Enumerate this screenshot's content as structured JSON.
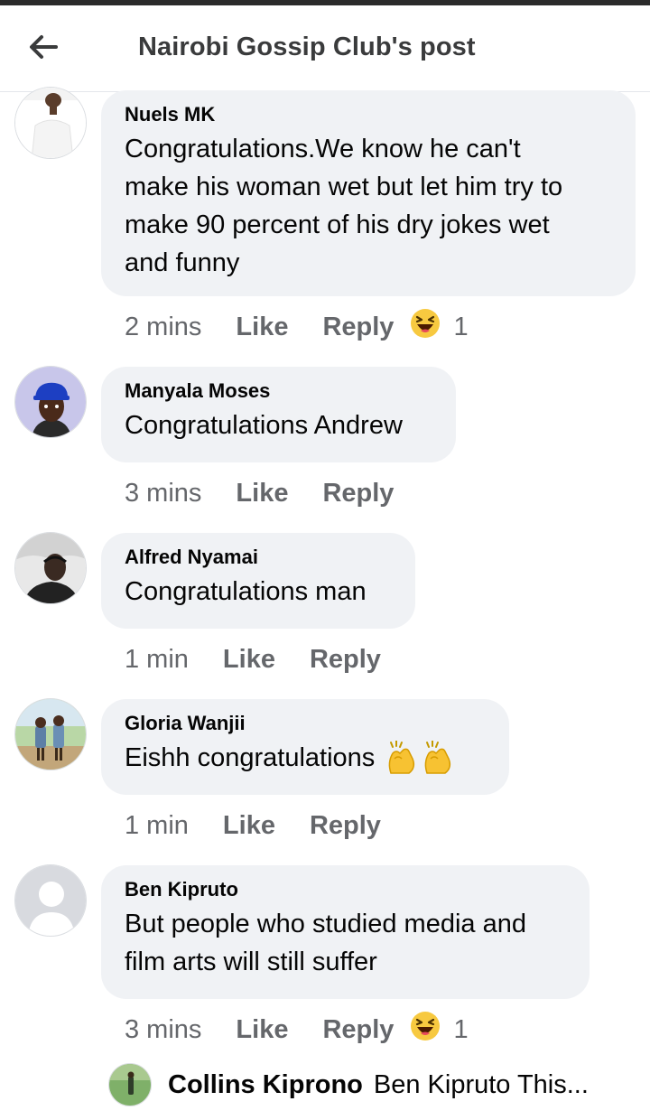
{
  "header": {
    "title": "Nairobi Gossip Club's post"
  },
  "icons": {
    "back": "arrow-left-icon",
    "haha": "haha-reaction-icon",
    "clap": "clapping-hands-emoji"
  },
  "comments": [
    {
      "author": "Nuels MK",
      "text": "Congratulations.We know he can't make his woman wet but let him try to make 90 percent of his dry jokes wet and funny",
      "lines": [
        "Congratulations.We know he can't",
        "make his woman wet but let him try to",
        "make 90 percent of his dry jokes wet",
        "and funny"
      ],
      "time": "2 mins",
      "like": "Like",
      "reply": "Reply",
      "reaction_count": "1"
    },
    {
      "author": "Manyala Moses",
      "text": "Congratulations Andrew",
      "time": "3 mins",
      "like": "Like",
      "reply": "Reply"
    },
    {
      "author": "Alfred Nyamai",
      "text": "Congratulations man",
      "time": "1 min",
      "like": "Like",
      "reply": "Reply"
    },
    {
      "author": "Gloria Wanjii",
      "text": "Eishh congratulations",
      "time": "1 min",
      "like": "Like",
      "reply": "Reply"
    },
    {
      "author": "Ben Kipruto",
      "text": "But people who studied media and film arts will still suffer",
      "lines": [
        "But people who studied media and",
        "film arts will still suffer"
      ],
      "time": "3 mins",
      "like": "Like",
      "reply": "Reply",
      "reaction_count": "1"
    }
  ],
  "reply_preview": {
    "author": "Collins Kiprono",
    "snippet": "Ben Kipruto This..."
  },
  "colors": {
    "bubble": "#f0f2f5",
    "meta_text": "#65676b",
    "haha_yellow": "#f7c940"
  }
}
